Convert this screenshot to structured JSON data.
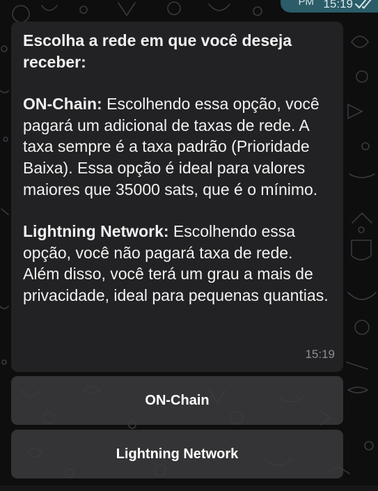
{
  "previous_message": {
    "time_prefix": "PM",
    "time": "15:19",
    "status_icon": "double-check-icon"
  },
  "message": {
    "line1": "Escolha a rede em que você deseja receber:",
    "onchain_title": "ON-Chain:",
    "onchain_text": " Escolhendo essa opção, você pagará um adicional de taxas de rede. A taxa sempre é a taxa padrão (Prioridade Baixa). Essa opção é ideal para valores maiores que 35000 sats, que é o mínimo.",
    "lightning_title": "Lightning Network:",
    "lightning_text": " Escolhendo essa opção, você não pagará taxa de rede. Além disso, você terá um grau a mais de privacidade, ideal para pequenas quantias.",
    "time": "15:19"
  },
  "keyboard": {
    "buttons": [
      {
        "label": "ON-Chain"
      },
      {
        "label": "Lightning Network"
      }
    ]
  },
  "colors": {
    "background": "#0e0e0f",
    "bubble": "#222224",
    "own_bubble": "#2b5c68",
    "button": "#3a3a3c",
    "text": "#f1f1f1",
    "time": "#8f8f93"
  }
}
